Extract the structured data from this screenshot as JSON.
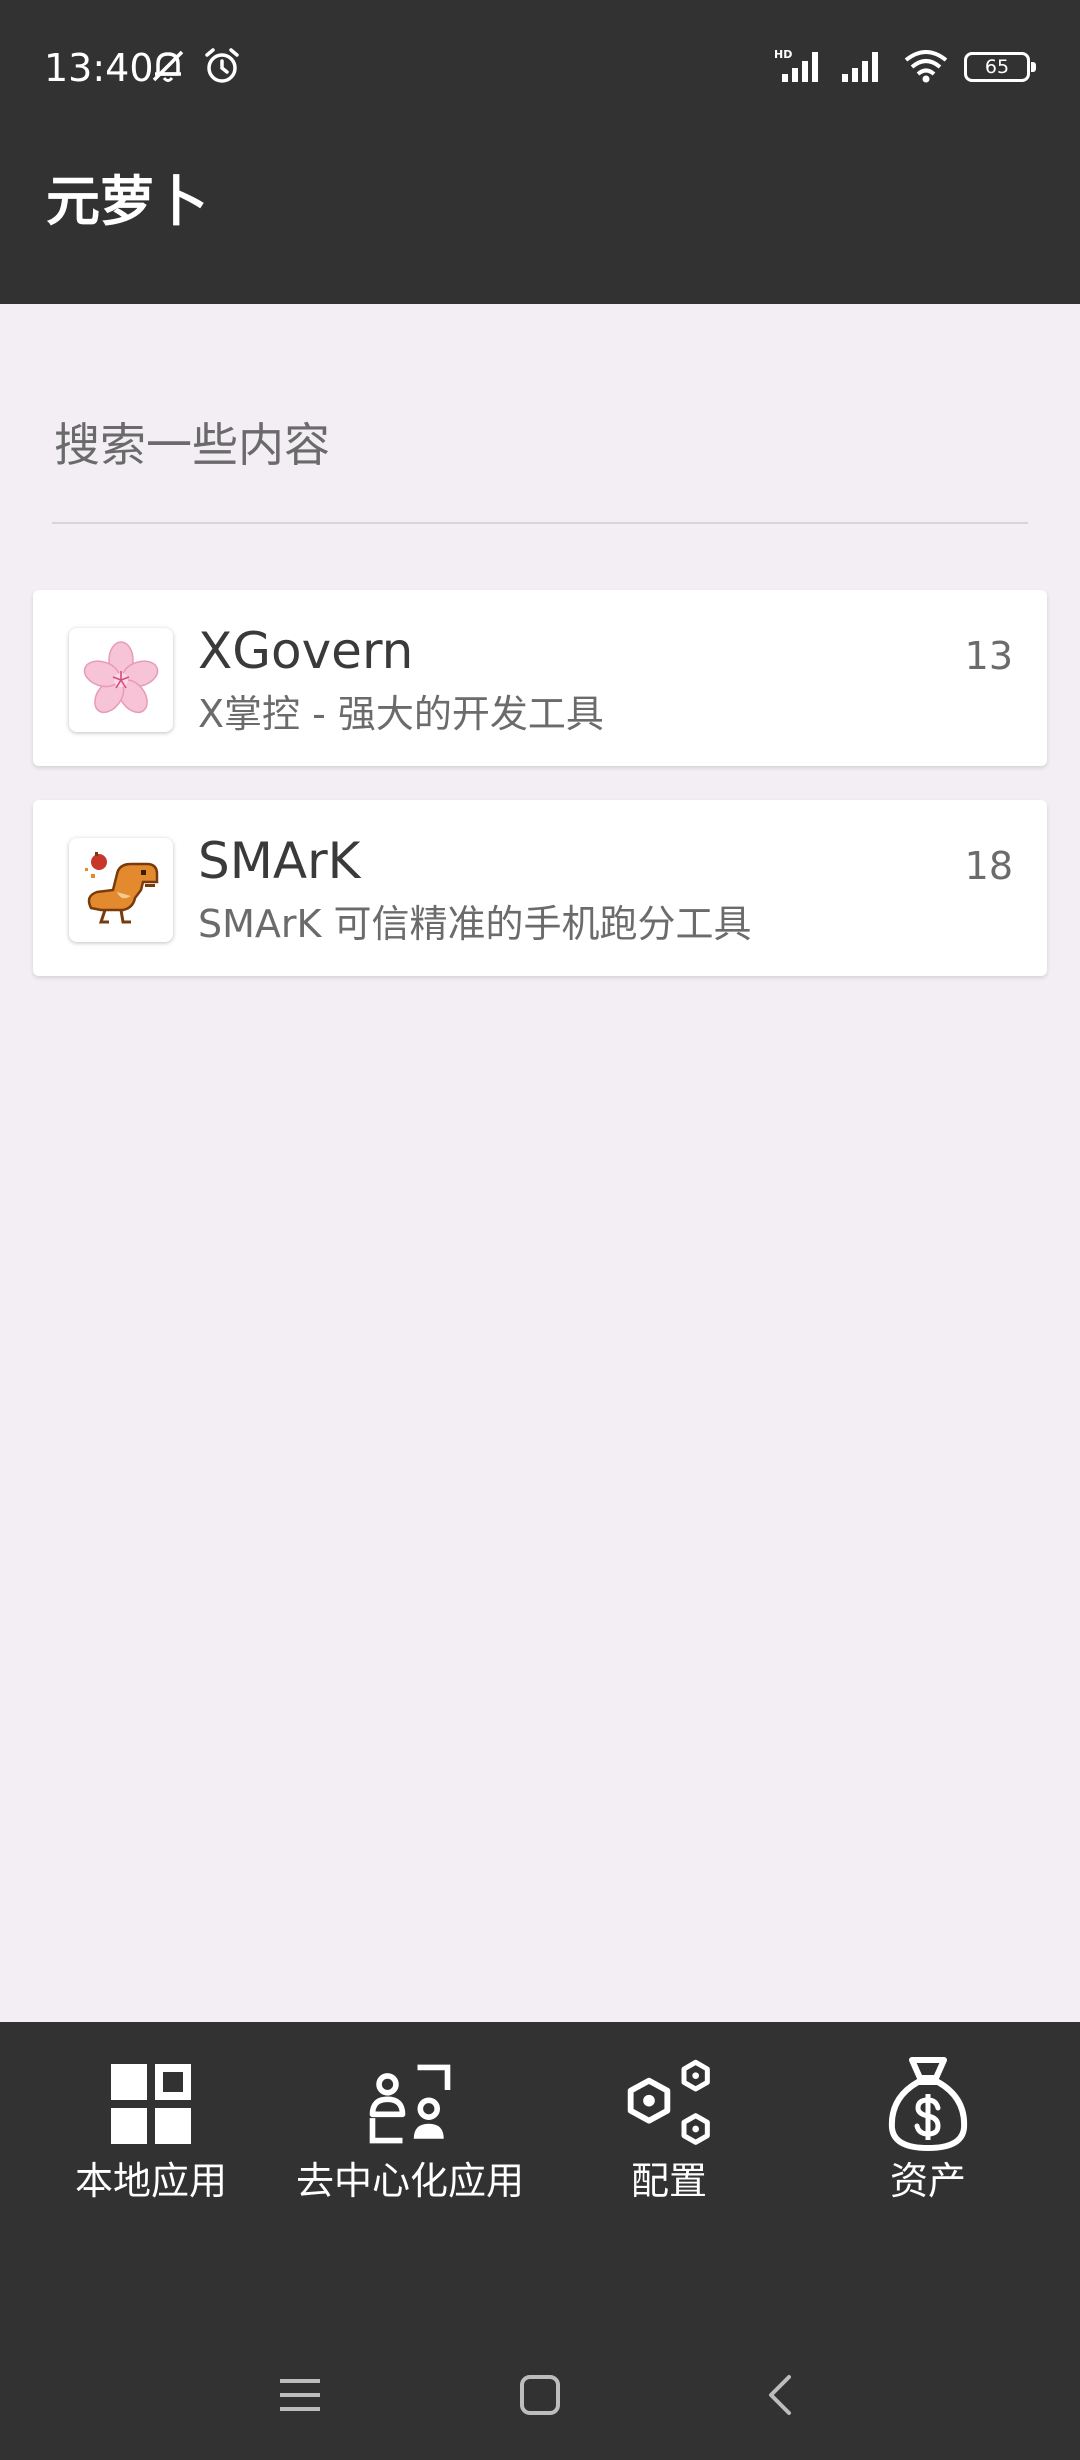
{
  "status_bar": {
    "time": "13:40",
    "battery": "65",
    "icons": [
      "bell-off-icon",
      "alarm-icon",
      "hd-signal-icon",
      "signal-icon",
      "wifi-icon",
      "battery-icon"
    ]
  },
  "app_bar": {
    "title": "元萝卜"
  },
  "search": {
    "placeholder": "搜索一些内容",
    "value": ""
  },
  "apps": [
    {
      "name": "XGovern",
      "description": "X掌控 - 强大的开发工具",
      "count": "13",
      "icon": "sakura-icon"
    },
    {
      "name": "SMArK",
      "description": "SMArK 可信精准的手机跑分工具",
      "count": "18",
      "icon": "dinosaur-icon"
    }
  ],
  "bottom_nav": [
    {
      "label": "本地应用",
      "icon": "grid-icon"
    },
    {
      "label": "去中心化应用",
      "icon": "users-icon"
    },
    {
      "label": "配置",
      "icon": "hexagons-icon"
    },
    {
      "label": "资产",
      "icon": "money-bag-icon"
    }
  ],
  "system_nav": [
    "menu-icon",
    "home-icon",
    "back-icon"
  ],
  "colors": {
    "bar_background": "#323232",
    "page_background": "#f2eef4",
    "card_background": "#ffffff"
  }
}
